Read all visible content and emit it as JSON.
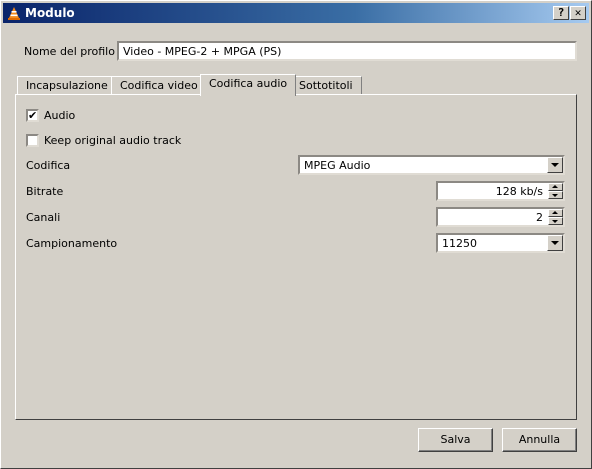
{
  "window": {
    "title": "Modulo",
    "help_glyph": "?",
    "close_glyph": "✕"
  },
  "profile": {
    "label": "Nome del profilo",
    "value": "Video - MPEG-2 + MPGA (PS)"
  },
  "tabs": [
    {
      "label": "Incapsulazione"
    },
    {
      "label": "Codifica video"
    },
    {
      "label": "Codifica audio"
    },
    {
      "label": "Sottotitoli"
    }
  ],
  "audio": {
    "audio_checkbox": {
      "label": "Audio",
      "checked": true,
      "mark": "✔"
    },
    "keep_original": {
      "label": "Keep original audio track",
      "checked": false
    },
    "codec": {
      "label": "Codifica",
      "value": "MPEG Audio"
    },
    "bitrate": {
      "label": "Bitrate",
      "value": "128 kb/s"
    },
    "channels": {
      "label": "Canali",
      "value": "2"
    },
    "samplerate": {
      "label": "Campionamento",
      "value": "11250"
    }
  },
  "buttons": {
    "save": "Salva",
    "cancel": "Annulla"
  }
}
